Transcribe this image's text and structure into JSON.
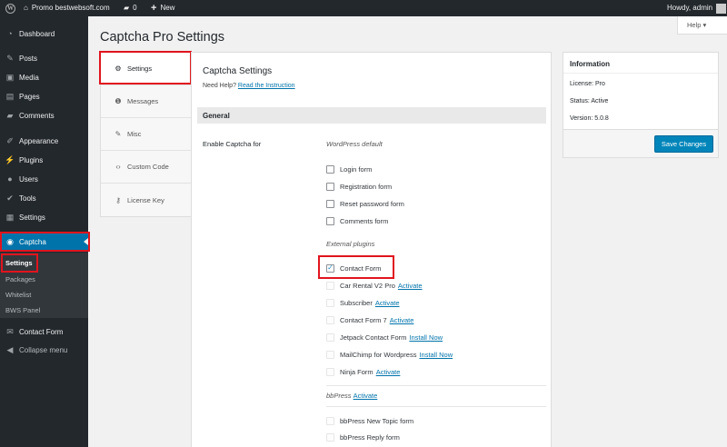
{
  "admin_bar": {
    "site_name": "Promo bestwebsoft.com",
    "comments_count": "0",
    "new_label": "New",
    "greeting": "Howdy, admin"
  },
  "sidebar": {
    "items": [
      {
        "label": "Dashboard",
        "icon": "dashboard-icon"
      },
      {
        "label": "Posts",
        "icon": "pin-icon"
      },
      {
        "label": "Media",
        "icon": "media-icon"
      },
      {
        "label": "Pages",
        "icon": "page-icon"
      },
      {
        "label": "Comments",
        "icon": "comment-icon"
      },
      {
        "label": "Appearance",
        "icon": "brush-icon"
      },
      {
        "label": "Plugins",
        "icon": "plug-icon"
      },
      {
        "label": "Users",
        "icon": "user-icon"
      },
      {
        "label": "Tools",
        "icon": "wrench-icon"
      },
      {
        "label": "Settings",
        "icon": "sliders-icon"
      },
      {
        "label": "Captcha",
        "icon": "eye-icon"
      },
      {
        "label": "Contact Form",
        "icon": "mail-icon"
      },
      {
        "label": "Collapse menu",
        "icon": "collapse-icon"
      }
    ],
    "submenu": [
      "Settings",
      "Packages",
      "Whitelist",
      "BWS Panel"
    ]
  },
  "page_title": "Captcha Pro Settings",
  "help_button": "Help ▾",
  "tabs": [
    {
      "label": "Settings",
      "icon": "gear-icon"
    },
    {
      "label": "Messages",
      "icon": "info-icon"
    },
    {
      "label": "Misc",
      "icon": "wrench-icon"
    },
    {
      "label": "Custom Code",
      "icon": "code-icon"
    },
    {
      "label": "License Key",
      "icon": "key-icon"
    }
  ],
  "panel": {
    "title": "Captcha Settings",
    "need_help": "Need Help?",
    "instruction_link": "Read the Instruction",
    "section_general": "General",
    "enable_label": "Enable Captcha for",
    "wp_default_heading": "WordPress default",
    "wp_default": [
      "Login form",
      "Registration form",
      "Reset password form",
      "Comments form"
    ],
    "external_heading": "External plugins",
    "external": [
      {
        "label": "Contact Form",
        "link": "",
        "checked": true
      },
      {
        "label": "Car Rental V2 Pro",
        "link": "Activate",
        "checked": false
      },
      {
        "label": "Subscriber",
        "link": "Activate",
        "checked": false
      },
      {
        "label": "Contact Form 7",
        "link": "Activate",
        "checked": false
      },
      {
        "label": "Jetpack Contact Form",
        "link": "Install Now",
        "checked": false
      },
      {
        "label": "MailChimp for Wordpress",
        "link": "Install Now",
        "checked": false
      },
      {
        "label": "Ninja Form",
        "link": "Activate",
        "checked": false
      }
    ],
    "bbpress_heading": "bbPress",
    "bbpress_link": "Activate",
    "bbpress": [
      "bbPress New Topic form",
      "bbPress Reply form"
    ]
  },
  "info": {
    "title": "Information",
    "license": "License: Pro",
    "status": "Status: Active",
    "version": "Version: 5.0.8",
    "save_button": "Save Changes"
  },
  "colors": {
    "accent": "#0073aa",
    "highlight": "#e1141e",
    "admin_bar": "#23282d"
  }
}
